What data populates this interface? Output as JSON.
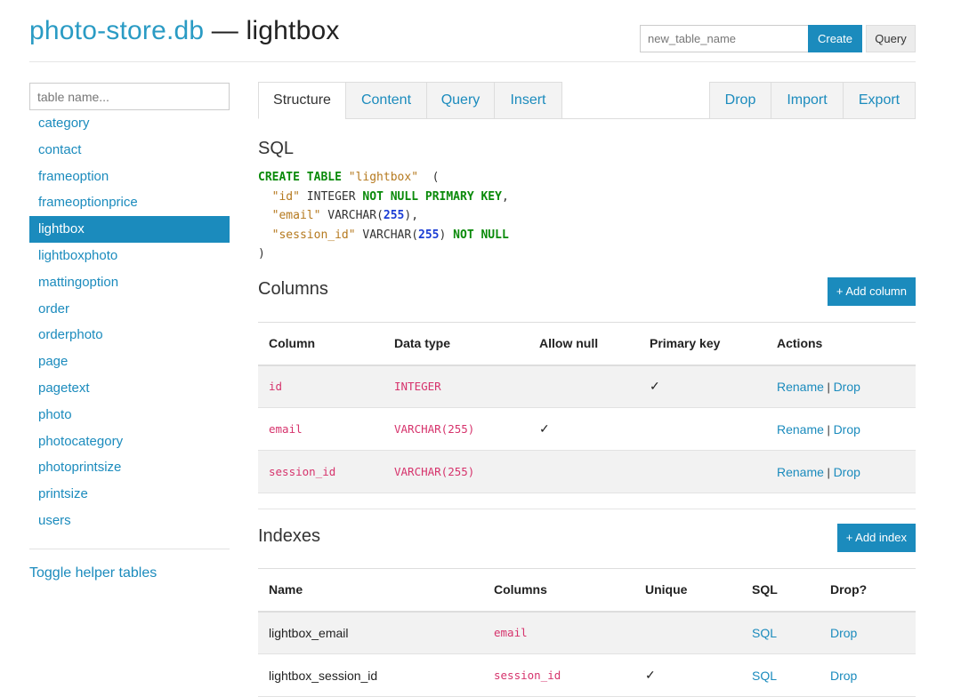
{
  "header": {
    "db_name": "photo-store.db",
    "separator": " — ",
    "table_name": "lightbox",
    "new_table_placeholder": "new_table_name",
    "create_label": "Create",
    "query_label": "Query"
  },
  "sidebar": {
    "filter_placeholder": "table name...",
    "tables": [
      "category",
      "contact",
      "frameoption",
      "frameoptionprice",
      "lightbox",
      "lightboxphoto",
      "mattingoption",
      "order",
      "orderphoto",
      "page",
      "pagetext",
      "photo",
      "photocategory",
      "photoprintsize",
      "printsize",
      "users"
    ],
    "active_table": "lightbox",
    "toggle_label": "Toggle helper tables"
  },
  "tabs": {
    "left": [
      "Structure",
      "Content",
      "Query",
      "Insert"
    ],
    "right": [
      "Drop",
      "Import",
      "Export"
    ],
    "active": "Structure"
  },
  "sql": {
    "heading": "SQL"
  },
  "columns": {
    "heading": "Columns",
    "add_label": "+ Add column",
    "headers": [
      "Column",
      "Data type",
      "Allow null",
      "Primary key",
      "Actions"
    ],
    "rows": [
      {
        "name": "id",
        "type": "INTEGER",
        "allow_null": "",
        "primary_key": "✓"
      },
      {
        "name": "email",
        "type": "VARCHAR(255)",
        "allow_null": "✓",
        "primary_key": ""
      },
      {
        "name": "session_id",
        "type": "VARCHAR(255)",
        "allow_null": "",
        "primary_key": ""
      }
    ],
    "rename_label": "Rename",
    "action_sep": "|",
    "drop_label": "Drop"
  },
  "indexes": {
    "heading": "Indexes",
    "add_label": "+ Add index",
    "headers": [
      "Name",
      "Columns",
      "Unique",
      "SQL",
      "Drop?"
    ],
    "rows": [
      {
        "name": "lightbox_email",
        "columns": "email",
        "unique": "",
        "sql": "SQL",
        "drop": "Drop"
      },
      {
        "name": "lightbox_session_id",
        "columns": "session_id",
        "unique": "✓",
        "sql": "SQL",
        "drop": "Drop"
      }
    ]
  },
  "colors": {
    "accent": "#1b8bbd",
    "keyword": "#0a8a0a",
    "string": "#b5791e",
    "number": "#1a3cd4",
    "mono_value": "#d6336c"
  }
}
